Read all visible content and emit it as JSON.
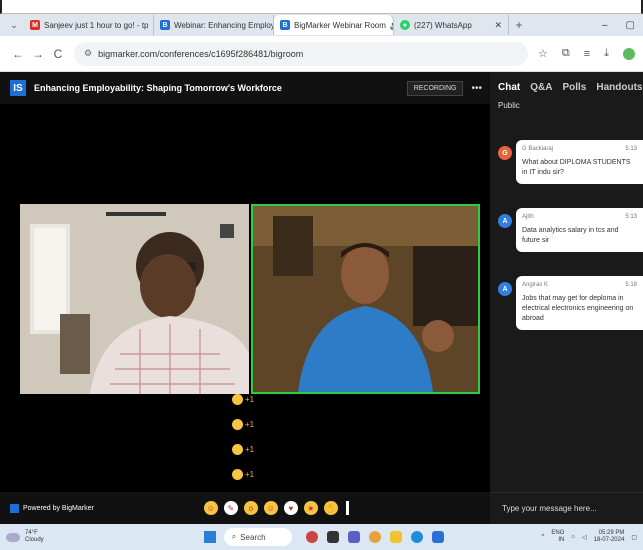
{
  "browser": {
    "tabs": [
      {
        "label": "Sanjeev just 1 hour to go! - tp",
        "icon": "gmail-icon",
        "color": "#d93025",
        "active": false
      },
      {
        "label": "Webinar: Enhancing Employabil",
        "icon": "bigmarker-icon",
        "color": "#1d6fd6",
        "active": false
      },
      {
        "label": "BigMarker Webinar Room",
        "icon": "bigmarker-icon",
        "color": "#1d6fd6",
        "active": true
      },
      {
        "label": "(227) WhatsApp",
        "icon": "whatsapp-icon",
        "color": "#25d366",
        "active": false
      }
    ],
    "url": "bigmarker.com/conferences/c1695f286481/bigroom"
  },
  "app": {
    "logo": "IS",
    "title": "Enhancing Employability: Shaping Tomorrow's Workforce",
    "recording_label": "RECORDING",
    "more_label": "•••",
    "powered_by": "Powered by BigMarker",
    "emoji_counts": [
      "+1",
      "+1",
      "+1",
      "+1"
    ]
  },
  "chat": {
    "tabs": [
      "Chat",
      "Q&A",
      "Polls",
      "Handouts"
    ],
    "active_tab": "Chat",
    "channel": "Public",
    "messages": [
      {
        "initial": "G",
        "avatar_color": "#e7643a",
        "name": "G Backiaraj",
        "time": "5:13",
        "text": "What about DIPLOMA STUDENTS in IT indu sir?"
      },
      {
        "initial": "A",
        "avatar_color": "#2f7ee0",
        "name": "Ajith",
        "time": "5:13",
        "text": "Data analytics salary in tcs and future sir"
      },
      {
        "initial": "A",
        "avatar_color": "#2f7ee0",
        "name": "Angiras K",
        "time": "5:18",
        "text": "Jobs that may get for deploma in electrical electronics engineering on abroad"
      }
    ],
    "input_placeholder": "Type your message here..."
  },
  "taskbar": {
    "temperature": "74°F",
    "weather_desc": "Cloudy",
    "search_placeholder": "Search",
    "lang": "ENG",
    "lang_sub": "IN",
    "time": "05:29 PM",
    "date": "18-07-2024"
  }
}
